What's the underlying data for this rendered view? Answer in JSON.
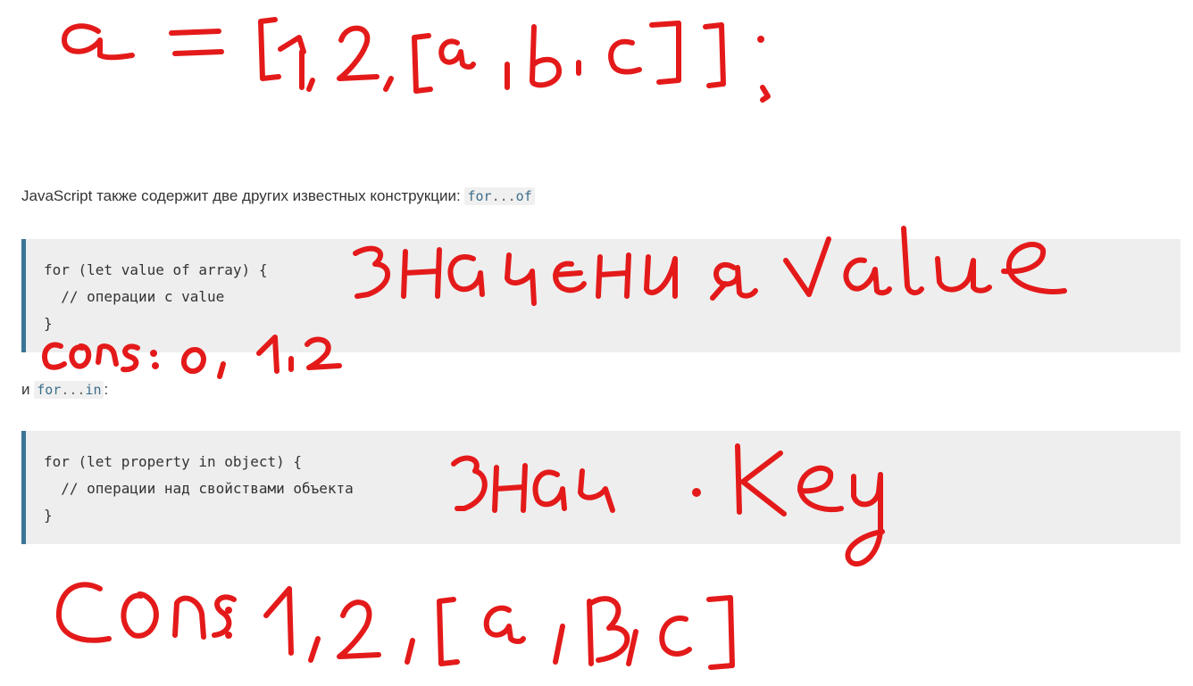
{
  "paragraph1": {
    "text": "JavaScript также содержит две других известных конструкции: ",
    "code_for": "for",
    "code_sep": "...",
    "code_kw": "of"
  },
  "code_block_1": {
    "lines": [
      "for (let value of array) {",
      "  // операции с value",
      "}"
    ]
  },
  "paragraph2": {
    "prefix": "и ",
    "code_for": "for",
    "code_sep": "...",
    "code_kw": "in",
    "suffix": ":"
  },
  "code_block_2": {
    "lines": [
      "for (let property in object) {",
      "  // операции над свойствами объекта",
      "}"
    ]
  },
  "handwriting": {
    "top_line": "a = [1, 2, [a, b, c]];",
    "note_value": "значения value",
    "cons_1": "cons: 0, 1, 2",
    "note_key": "знач .key",
    "cons_2": "cons: 1, 2, [a, b, c]",
    "ink_color": "#e41a1a"
  }
}
